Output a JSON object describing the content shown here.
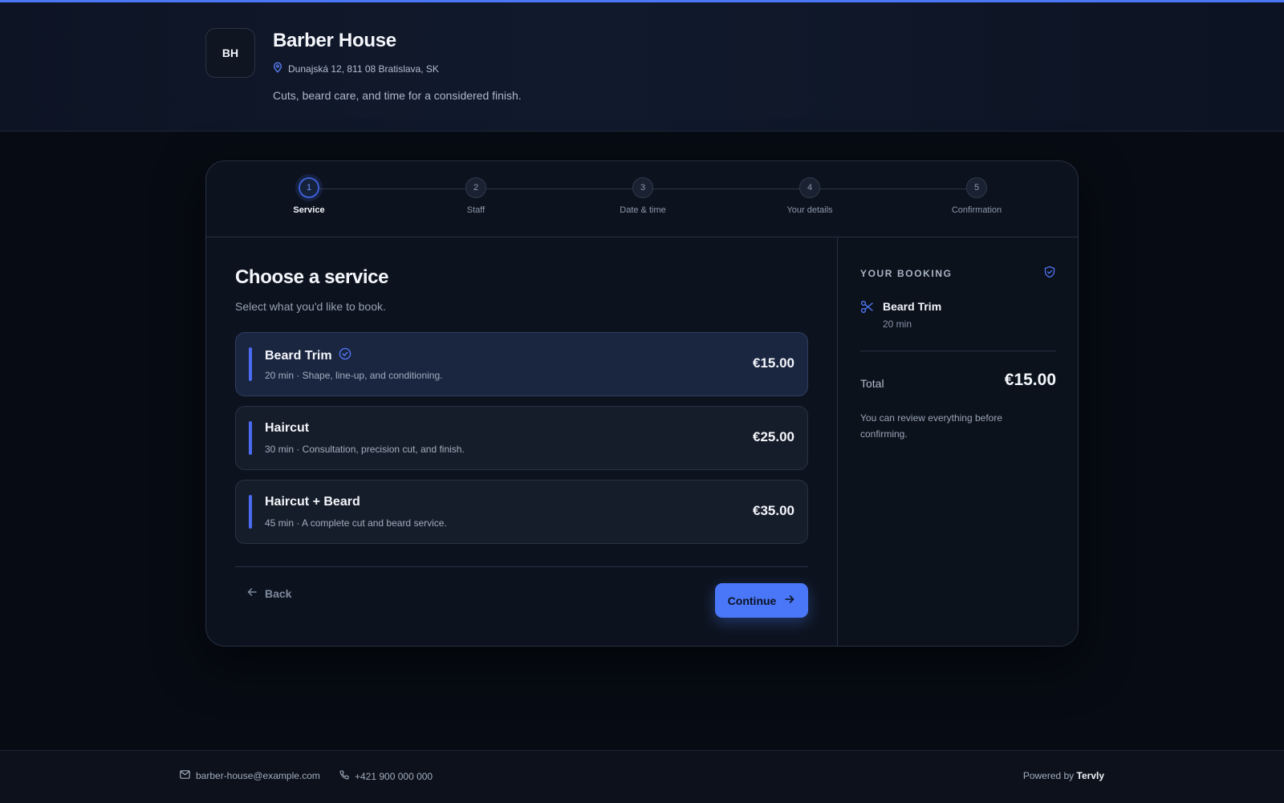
{
  "colors": {
    "accent": "#4a77f7",
    "background": "#070b13",
    "card": "#0d131e",
    "selected": "#1a2540"
  },
  "header": {
    "logo_initials": "BH",
    "name": "Barber House",
    "address": "Dunajská 12, 811 08 Bratislava, SK",
    "tagline": "Cuts, beard care, and time for a considered finish.",
    "address_icon": "map-pin-icon"
  },
  "stepper": {
    "active_step": 1,
    "steps": [
      {
        "number": "1",
        "label": "Service"
      },
      {
        "number": "2",
        "label": "Staff"
      },
      {
        "number": "3",
        "label": "Date & time"
      },
      {
        "number": "4",
        "label": "Your details"
      },
      {
        "number": "5",
        "label": "Confirmation"
      }
    ]
  },
  "main": {
    "title": "Choose a service",
    "subtitle": "Select what you'd like to book.",
    "services": [
      {
        "name": "Beard Trim",
        "description": "20 min · Shape, line-up, and conditioning.",
        "price": "€15.00",
        "selected": true
      },
      {
        "name": "Haircut",
        "description": "30 min · Consultation, precision cut, and finish.",
        "price": "€25.00",
        "selected": false
      },
      {
        "name": "Haircut + Beard",
        "description": "45 min · A complete cut and beard service.",
        "price": "€35.00",
        "selected": false
      }
    ],
    "back_label": "Back",
    "continue_label": "Continue"
  },
  "booking": {
    "title": "YOUR BOOKING",
    "item_name": "Beard Trim",
    "item_duration": "20 min",
    "total_label": "Total",
    "total_value": "€15.00",
    "note": "You can review everything before confirming.",
    "item_icon": "scissors-icon",
    "badge_icon": "shield-check-icon"
  },
  "footer": {
    "email": "barber-house@example.com",
    "phone": "+421 900 000 000",
    "powered_prefix": "Powered by",
    "powered_brand": "Tervly"
  }
}
